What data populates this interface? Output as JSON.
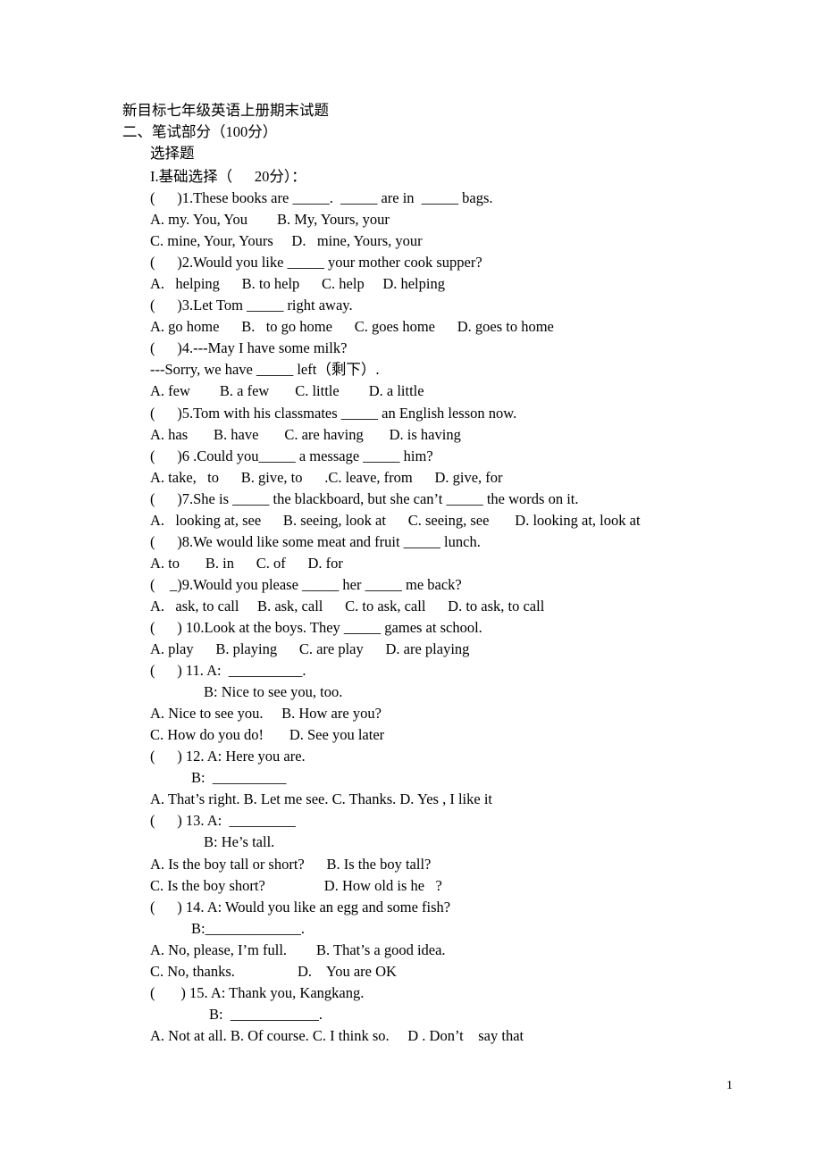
{
  "document": {
    "title": "新目标七年级英语上册期末试题",
    "section_heading": "二、笔试部分（100分）",
    "sub_heading": "选择题",
    "part_heading": "I.基础选择（      20分）："
  },
  "questions": [
    {
      "stem": "(      )1.These books are _____.  _____ are in  _____ bags.",
      "options": [
        "A. my. You, You        B. My, Yours, your",
        "C. mine, Your, Yours     D.   mine, Yours, your"
      ]
    },
    {
      "stem": "(      )2.Would you like _____ your mother cook supper?",
      "options": [
        "A.   helping      B. to help      C. help     D. helping"
      ]
    },
    {
      "stem": "(      )3.Let Tom _____ right away.",
      "options": [
        "A. go home      B.   to go home      C. goes home      D. goes to home"
      ]
    },
    {
      "stem": "(      )4.---May I have some milk?",
      "continuation": "---Sorry, we have _____ left（剩下）.",
      "options": [
        "A. few        B. a few       C. little        D. a little"
      ]
    },
    {
      "stem": "(      )5.Tom with his classmates _____ an English lesson now.",
      "options": [
        "A. has       B. have       C. are having       D. is having"
      ]
    },
    {
      "stem": "(      )6 .Could you_____ a message _____ him?",
      "options": [
        "A. take,   to      B. give, to      .C. leave, from      D. give, for"
      ]
    },
    {
      "stem": "(      )7.She is _____ the blackboard, but she can’t _____ the words on it.",
      "options": [
        "A.   looking at, see      B. seeing, look at      C. seeing, see       D. looking at, look at"
      ]
    },
    {
      "stem": "(      )8.We would like some meat and fruit _____ lunch.",
      "options": [
        "A. to       B. in      C. of      D. for"
      ]
    },
    {
      "stem": "(    _)9.Would you please _____ her _____ me back?",
      "options": [
        "A.   ask, to call     B. ask, call      C. to ask, call      D. to ask, to call"
      ]
    },
    {
      "stem": "(      ) 10.Look at the boys. They _____ games at school.",
      "options": [
        "A. play      B. playing      C. are play      D. are playing"
      ]
    },
    {
      "stem": "(      ) 11. A:  __________.",
      "reply": "B: Nice to see you, too.",
      "options": [
        "A. Nice to see you.     B. How are you?",
        "C. How do you do!       D. See you later"
      ]
    },
    {
      "stem": "(      ) 12. A: Here you are.",
      "reply": "B:  __________",
      "options": [
        "A. That’s right. B. Let me see. C. Thanks. D. Yes , I like it"
      ]
    },
    {
      "stem": "(      ) 13. A:  _________",
      "reply": "B: He’s tall.",
      "options": [
        "A. Is the boy tall or short?      B. Is the boy tall?",
        "C. Is the boy short?                D. How old is he   ?"
      ]
    },
    {
      "stem": "(      ) 14. A: Would you like an egg and some fish?",
      "reply": "B:_____________.",
      "options": [
        "A. No, please, I’m full.        B. That’s a good idea.",
        "C. No, thanks.                 D.    You are OK"
      ]
    },
    {
      "stem": "(       ) 15. A: Thank you, Kangkang.",
      "reply": "B:  ____________.",
      "options": [
        "A. Not at all. B. Of course. C. I think so.     D . Don’t    say that"
      ]
    }
  ],
  "footer": {
    "page_number": "1"
  }
}
